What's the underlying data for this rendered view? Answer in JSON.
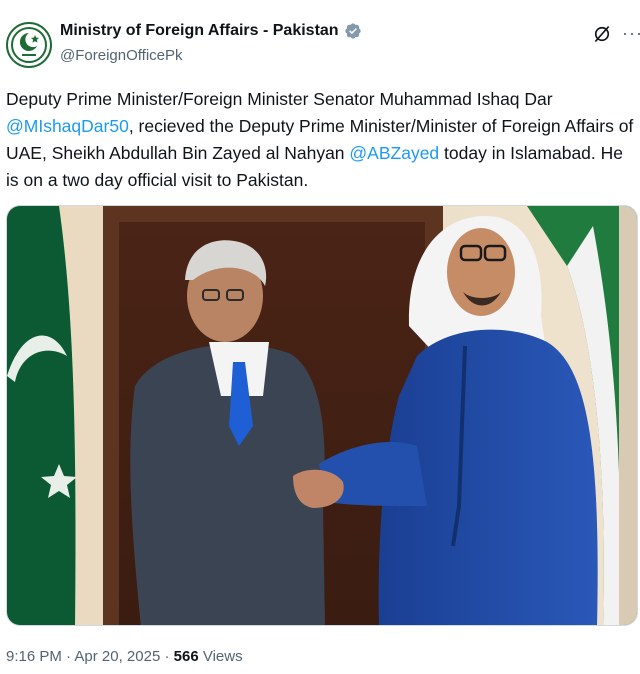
{
  "account": {
    "name": "Ministry of Foreign Affairs - Pakistan",
    "handle": "@ForeignOfficePk",
    "verified": true
  },
  "tweet": {
    "text_part1": "Deputy Prime Minister/Foreign Minister Senator Muhammad Ishaq Dar ",
    "mention1": "@MIshaqDar50",
    "text_part2": ", recieved the Deputy Prime Minister/Minister of Foreign Affairs of UAE, Sheikh Abdullah Bin Zayed al Nahyan ",
    "mention2": "@ABZayed",
    "text_part3": " today in Islamabad. He is on a two day official visit to Pakistan."
  },
  "meta": {
    "time": "9:16 PM",
    "date": "Apr 20, 2025",
    "separator": "·",
    "views_count": "566",
    "views_label": "Views"
  },
  "colors": {
    "accent": "#1d9bf0",
    "verified_badge": "#829aab",
    "text": "#0f1419",
    "secondary": "#536471"
  },
  "icons": {
    "verified": "verified-badge-icon",
    "grok": "grok-icon",
    "more": "more-options-icon"
  }
}
